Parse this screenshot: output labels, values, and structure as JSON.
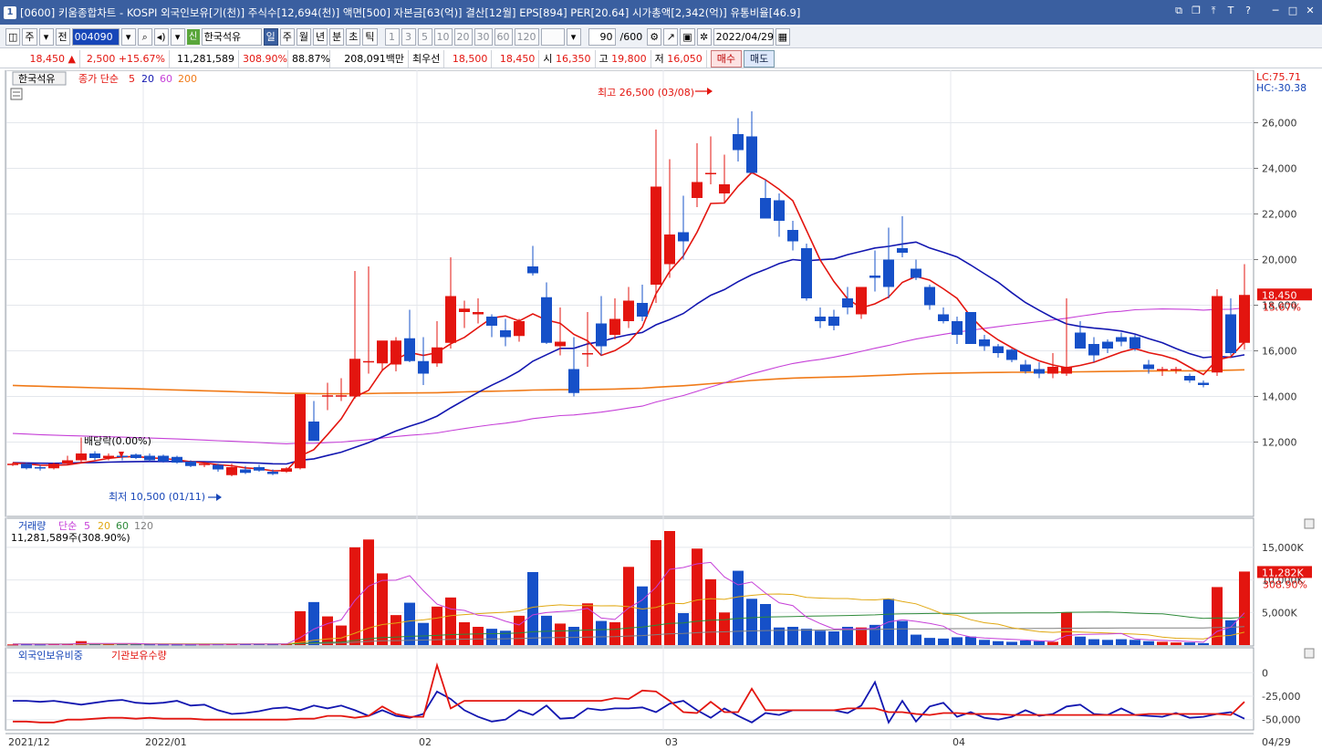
{
  "window": {
    "title": "[0600] 키움종합차트 - KOSPI 외국인보유[기(천)] 주식수[12,694(천)] 액면[500] 자본금[63(억)] 결산[12월] EPS[894] PER[20.64] 시가총액[2,342(억)] 유통비율[46.9]",
    "icon": "1"
  },
  "toolbar": {
    "mode1": "주",
    "mode2": "전",
    "code": "004090",
    "shin": "신",
    "stock_name": "한국석유",
    "periods": [
      "일",
      "주",
      "월",
      "년",
      "분",
      "초",
      "틱"
    ],
    "active_period": "일",
    "minutes": [
      "1",
      "3",
      "5",
      "10",
      "20",
      "30",
      "60",
      "120"
    ],
    "count": "90",
    "count_total": "/600",
    "date": "2022/04/29"
  },
  "quote": {
    "price": "18,450",
    "change_arrow": "▲",
    "change": "2,500",
    "change_pct": "+15.67%",
    "volume": "11,281,589",
    "volume_ratio": "308.90%",
    "ratio2": "88.87%",
    "amount": "208,091백만",
    "best_label": "최우선",
    "ask": "18,500",
    "bid": "18,450",
    "open_label": "시",
    "open": "16,350",
    "high_label": "고",
    "high": "19,800",
    "low_label": "저",
    "low": "16,050",
    "buy_btn": "매수",
    "sell_btn": "매도"
  },
  "legend": {
    "name": "한국석유",
    "ma_label": "종가 단순",
    "ma_periods": [
      "5",
      "20",
      "60",
      "200"
    ],
    "vol_label": "거래량",
    "vol_ma_label": "단순",
    "vol_ma_periods": [
      "5",
      "20",
      "60",
      "120"
    ],
    "vol_value": "11,281,589주(308.90%)",
    "sub_label1": "외국인보유비중",
    "sub_label2": "기관보유수량"
  },
  "annotations": {
    "high": "최고 26,500 (03/08)",
    "low": "최저 10,500 (01/11)",
    "dividend": "배당락(0.00%)",
    "lc": "LC:75.71",
    "hc": "HC:-30.38",
    "last_price": "18,450",
    "last_pct": "15.67%",
    "last_vol": "11,282K",
    "last_vol_pct": "308.90%"
  },
  "colors": {
    "up": "#e3150f",
    "down": "#1650c8",
    "ma5": "#e3150f",
    "ma20": "#1216b0",
    "ma60": "#c640d8",
    "ma200": "#f07a18",
    "vma20": "#e1a812",
    "vma60": "#2e8a3a",
    "vma120": "#808080"
  },
  "chart_data": {
    "type": "candlestick",
    "price_ticks": [
      "26,000",
      "24,000",
      "22,000",
      "20,000",
      "18,000",
      "16,000",
      "14,000",
      "12,000"
    ],
    "volume_ticks": [
      "15,000K",
      "10,000K",
      "5,000K"
    ],
    "sub_ticks": [
      "0",
      "-25,000",
      "-50,000"
    ],
    "x_labels": [
      "2021/12",
      "2022/01",
      "02",
      "03",
      "04",
      "04/29"
    ],
    "price_ylim": [
      9500,
      27500
    ],
    "volume_ylim": [
      0,
      17500
    ],
    "candles": [
      {
        "o": 11000,
        "h": 11100,
        "l": 10950,
        "c": 11050,
        "v": 100
      },
      {
        "o": 11050,
        "h": 11100,
        "l": 10800,
        "c": 10850,
        "v": 120
      },
      {
        "o": 10900,
        "h": 11000,
        "l": 10750,
        "c": 10850,
        "v": 110
      },
      {
        "o": 10850,
        "h": 11100,
        "l": 10800,
        "c": 11050,
        "v": 150
      },
      {
        "o": 11050,
        "h": 11400,
        "l": 11000,
        "c": 11200,
        "v": 180
      },
      {
        "o": 11200,
        "h": 12200,
        "l": 11100,
        "c": 11500,
        "v": 600
      },
      {
        "o": 11500,
        "h": 11600,
        "l": 11200,
        "c": 11300,
        "v": 200
      },
      {
        "o": 11300,
        "h": 11500,
        "l": 11200,
        "c": 11400,
        "v": 150
      },
      {
        "o": 11400,
        "h": 11500,
        "l": 11200,
        "c": 11350,
        "v": 140
      },
      {
        "o": 11450,
        "h": 11500,
        "l": 11250,
        "c": 11300,
        "v": 130
      },
      {
        "o": 11400,
        "h": 11500,
        "l": 11150,
        "c": 11200,
        "v": 120
      },
      {
        "o": 11400,
        "h": 11450,
        "l": 11100,
        "c": 11150,
        "v": 110
      },
      {
        "o": 11350,
        "h": 11400,
        "l": 11050,
        "c": 11100,
        "v": 100
      },
      {
        "o": 11150,
        "h": 11200,
        "l": 10900,
        "c": 10950,
        "v": 100
      },
      {
        "o": 11000,
        "h": 11100,
        "l": 10900,
        "c": 11050,
        "v": 120
      },
      {
        "o": 11000,
        "h": 11050,
        "l": 10700,
        "c": 10800,
        "v": 130
      },
      {
        "o": 10550,
        "h": 11050,
        "l": 10500,
        "c": 10900,
        "v": 200
      },
      {
        "o": 10800,
        "h": 10950,
        "l": 10600,
        "c": 10650,
        "v": 150
      },
      {
        "o": 10900,
        "h": 11000,
        "l": 10700,
        "c": 10750,
        "v": 140
      },
      {
        "o": 10700,
        "h": 10800,
        "l": 10550,
        "c": 10600,
        "v": 130
      },
      {
        "o": 10700,
        "h": 10900,
        "l": 10650,
        "c": 10850,
        "v": 150
      },
      {
        "o": 10850,
        "h": 14100,
        "l": 10800,
        "c": 14100,
        "v": 5200
      },
      {
        "o": 12900,
        "h": 13800,
        "l": 12800,
        "c": 12050,
        "v": 6600
      },
      {
        "o": 14000,
        "h": 14600,
        "l": 13400,
        "c": 14050,
        "v": 4400
      },
      {
        "o": 14000,
        "h": 14800,
        "l": 13800,
        "c": 14050,
        "v": 3000
      },
      {
        "o": 14000,
        "h": 19500,
        "l": 13900,
        "c": 15650,
        "v": 15000
      },
      {
        "o": 15500,
        "h": 19700,
        "l": 15000,
        "c": 15550,
        "v": 16200
      },
      {
        "o": 15450,
        "h": 16300,
        "l": 15100,
        "c": 16450,
        "v": 11000
      },
      {
        "o": 15400,
        "h": 16600,
        "l": 15100,
        "c": 16450,
        "v": 4600
      },
      {
        "o": 16550,
        "h": 17800,
        "l": 15500,
        "c": 15550,
        "v": 6500
      },
      {
        "o": 15550,
        "h": 16600,
        "l": 14500,
        "c": 15000,
        "v": 3400
      },
      {
        "o": 15450,
        "h": 17300,
        "l": 15300,
        "c": 16150,
        "v": 5900
      },
      {
        "o": 16350,
        "h": 20100,
        "l": 16100,
        "c": 18400,
        "v": 7300
      },
      {
        "o": 17700,
        "h": 18200,
        "l": 17000,
        "c": 17850,
        "v": 3500
      },
      {
        "o": 17600,
        "h": 18300,
        "l": 17200,
        "c": 17700,
        "v": 2800
      },
      {
        "o": 17500,
        "h": 17600,
        "l": 16600,
        "c": 17100,
        "v": 2500
      },
      {
        "o": 16900,
        "h": 17400,
        "l": 16200,
        "c": 16600,
        "v": 2200
      },
      {
        "o": 16650,
        "h": 17400,
        "l": 16400,
        "c": 17300,
        "v": 4500
      },
      {
        "o": 19700,
        "h": 20600,
        "l": 19300,
        "c": 19400,
        "v": 11200
      },
      {
        "o": 18350,
        "h": 19000,
        "l": 16300,
        "c": 16350,
        "v": 4500
      },
      {
        "o": 16200,
        "h": 17900,
        "l": 15800,
        "c": 16400,
        "v": 3300
      },
      {
        "o": 15200,
        "h": 16600,
        "l": 14000,
        "c": 14150,
        "v": 2800
      },
      {
        "o": 15900,
        "h": 17700,
        "l": 15300,
        "c": 15900,
        "v": 6400
      },
      {
        "o": 17200,
        "h": 18400,
        "l": 15800,
        "c": 16200,
        "v": 3700
      },
      {
        "o": 16700,
        "h": 18300,
        "l": 16500,
        "c": 17400,
        "v": 3500
      },
      {
        "o": 17300,
        "h": 18800,
        "l": 17000,
        "c": 18200,
        "v": 12000
      },
      {
        "o": 18100,
        "h": 18900,
        "l": 17300,
        "c": 17500,
        "v": 9000
      },
      {
        "o": 18900,
        "h": 25700,
        "l": 18100,
        "c": 23200,
        "v": 16100
      },
      {
        "o": 19800,
        "h": 24400,
        "l": 19200,
        "c": 21100,
        "v": 17500
      },
      {
        "o": 21200,
        "h": 22800,
        "l": 20000,
        "c": 20800,
        "v": 4900
      },
      {
        "o": 22700,
        "h": 25100,
        "l": 22300,
        "c": 23400,
        "v": 14800
      },
      {
        "o": 23800,
        "h": 25400,
        "l": 23300,
        "c": 23800,
        "v": 10100
      },
      {
        "o": 22900,
        "h": 24600,
        "l": 22500,
        "c": 23300,
        "v": 5000
      },
      {
        "o": 25500,
        "h": 26200,
        "l": 24300,
        "c": 24800,
        "v": 11400
      },
      {
        "o": 25400,
        "h": 26500,
        "l": 24900,
        "c": 23800,
        "v": 7100
      },
      {
        "o": 22700,
        "h": 23500,
        "l": 21800,
        "c": 21800,
        "v": 6300
      },
      {
        "o": 22600,
        "h": 22900,
        "l": 21000,
        "c": 21700,
        "v": 2700
      },
      {
        "o": 21300,
        "h": 21700,
        "l": 20400,
        "c": 20800,
        "v": 2800
      },
      {
        "o": 20500,
        "h": 20700,
        "l": 18200,
        "c": 18300,
        "v": 2500
      },
      {
        "o": 17500,
        "h": 17900,
        "l": 17000,
        "c": 17300,
        "v": 2200
      },
      {
        "o": 17500,
        "h": 17800,
        "l": 16900,
        "c": 17100,
        "v": 2100
      },
      {
        "o": 18300,
        "h": 18800,
        "l": 17600,
        "c": 17900,
        "v": 2800
      },
      {
        "o": 17600,
        "h": 18700,
        "l": 17400,
        "c": 18800,
        "v": 2700
      },
      {
        "o": 19300,
        "h": 20400,
        "l": 18600,
        "c": 19200,
        "v": 3100
      },
      {
        "o": 20000,
        "h": 21400,
        "l": 18300,
        "c": 18800,
        "v": 7100
      },
      {
        "o": 20500,
        "h": 21900,
        "l": 20100,
        "c": 20300,
        "v": 3700
      },
      {
        "o": 19600,
        "h": 20000,
        "l": 19100,
        "c": 19200,
        "v": 1600
      },
      {
        "o": 18800,
        "h": 18900,
        "l": 17800,
        "c": 18000,
        "v": 1100
      },
      {
        "o": 17600,
        "h": 17900,
        "l": 17200,
        "c": 17300,
        "v": 1000
      },
      {
        "o": 17300,
        "h": 17500,
        "l": 16300,
        "c": 16700,
        "v": 1200
      },
      {
        "o": 17700,
        "h": 17700,
        "l": 16400,
        "c": 16300,
        "v": 1300
      },
      {
        "o": 16500,
        "h": 16700,
        "l": 16000,
        "c": 16200,
        "v": 800
      },
      {
        "o": 16200,
        "h": 16300,
        "l": 15700,
        "c": 15900,
        "v": 600
      },
      {
        "o": 16050,
        "h": 16100,
        "l": 15500,
        "c": 15600,
        "v": 500
      },
      {
        "o": 15400,
        "h": 15600,
        "l": 15000,
        "c": 15100,
        "v": 700
      },
      {
        "o": 15200,
        "h": 15500,
        "l": 14800,
        "c": 15000,
        "v": 600
      },
      {
        "o": 15000,
        "h": 15900,
        "l": 14800,
        "c": 15300,
        "v": 500
      },
      {
        "o": 15000,
        "h": 18300,
        "l": 14900,
        "c": 15300,
        "v": 5000
      },
      {
        "o": 16800,
        "h": 17300,
        "l": 16300,
        "c": 16100,
        "v": 1300
      },
      {
        "o": 16300,
        "h": 16600,
        "l": 15500,
        "c": 15800,
        "v": 900
      },
      {
        "o": 16400,
        "h": 16500,
        "l": 15900,
        "c": 16100,
        "v": 800
      },
      {
        "o": 16600,
        "h": 16800,
        "l": 16200,
        "c": 16400,
        "v": 900
      },
      {
        "o": 16600,
        "h": 16700,
        "l": 16000,
        "c": 16100,
        "v": 800
      },
      {
        "o": 15400,
        "h": 15600,
        "l": 15000,
        "c": 15200,
        "v": 600
      },
      {
        "o": 15200,
        "h": 15300,
        "l": 14900,
        "c": 15200,
        "v": 500
      },
      {
        "o": 15200,
        "h": 15300,
        "l": 15000,
        "c": 15200,
        "v": 400
      },
      {
        "o": 14900,
        "h": 15000,
        "l": 14600,
        "c": 14700,
        "v": 400
      },
      {
        "o": 14600,
        "h": 14700,
        "l": 14400,
        "c": 14500,
        "v": 300
      },
      {
        "o": 15050,
        "h": 18700,
        "l": 14900,
        "c": 18400,
        "v": 8900
      },
      {
        "o": 17600,
        "h": 18300,
        "l": 15800,
        "c": 15900,
        "v": 3800
      },
      {
        "o": 16350,
        "h": 19800,
        "l": 16050,
        "c": 18450,
        "v": 11282
      }
    ],
    "foreign_ratio": [
      -30,
      -30,
      -31,
      -30,
      -32,
      -34,
      -32,
      -30,
      -29,
      -32,
      -33,
      -32,
      -30,
      -35,
      -34,
      -40,
      -44,
      -43,
      -41,
      -38,
      -37,
      -40,
      -35,
      -38,
      -35,
      -40,
      -46,
      -40,
      -46,
      -48,
      -44,
      -20,
      -28,
      -40,
      -47,
      -52,
      -50,
      -40,
      -45,
      -35,
      -49,
      -48,
      -38,
      -40,
      -38,
      -38,
      -37,
      -42,
      -33,
      -30,
      -40,
      -48,
      -38,
      -46,
      -53,
      -43,
      -45,
      -40,
      -40,
      -40,
      -40,
      -43,
      -35,
      -10,
      -53,
      -30,
      -52,
      -36,
      -32,
      -47,
      -42,
      -48,
      -50,
      -47,
      -40,
      -46,
      -44,
      -36,
      -34,
      -44,
      -45,
      -38,
      -45,
      -46,
      -47,
      -43,
      -48,
      -47,
      -44,
      -42,
      -49
    ],
    "institution": [
      -52,
      -52,
      -53,
      -53,
      -50,
      -50,
      -49,
      -48,
      -48,
      -49,
      -48,
      -49,
      -49,
      -49,
      -50,
      -50,
      -50,
      -50,
      -50,
      -50,
      -50,
      -49,
      -49,
      -46,
      -46,
      -48,
      -46,
      -36,
      -44,
      -47,
      -47,
      8,
      -38,
      -30,
      -30,
      -30,
      -30,
      -30,
      -30,
      -30,
      -30,
      -30,
      -30,
      -30,
      -27,
      -28,
      -19,
      -20,
      -30,
      -42,
      -43,
      -31,
      -42,
      -42,
      -17,
      -40,
      -40,
      -40,
      -40,
      -40,
      -40,
      -38,
      -38,
      -38,
      -42,
      -42,
      -44,
      -45,
      -43,
      -43,
      -44,
      -44,
      -44,
      -45,
      -45,
      -45,
      -45,
      -45,
      -45,
      -45,
      -45,
      -45,
      -45,
      -44,
      -44,
      -44,
      -44,
      -44,
      -44,
      -45,
      -31
    ]
  }
}
